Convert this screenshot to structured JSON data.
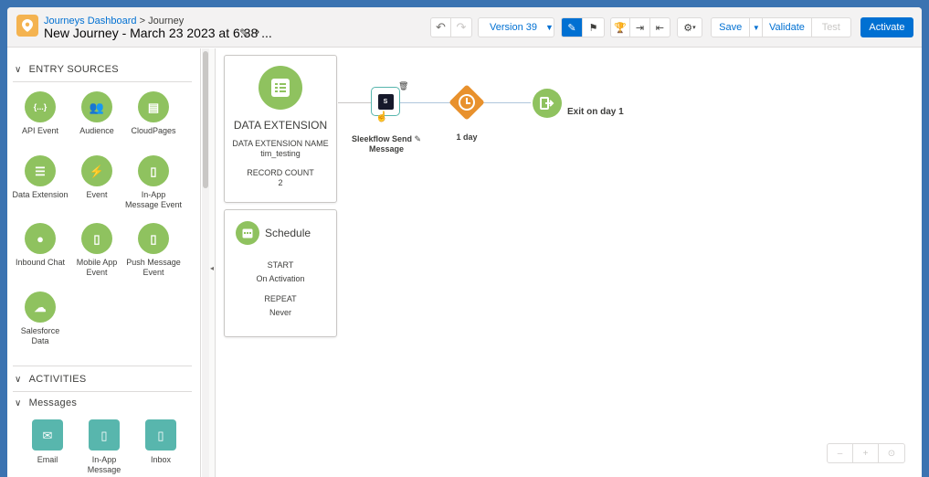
{
  "header": {
    "breadcrumb_link": "Journeys Dashboard",
    "breadcrumb_sep": ">",
    "breadcrumb_current": "Journey",
    "title": "New Journey - March 23 2023 at 6.38 ...",
    "version_label": "Version 39",
    "save_label": "Save",
    "validate_label": "Validate",
    "test_label": "Test",
    "activate_label": "Activate"
  },
  "sidebar": {
    "entry_sources_title": "ENTRY SOURCES",
    "entry_sources": [
      {
        "label": "API Event",
        "icon": "api-icon",
        "glyph": "{...}"
      },
      {
        "label": "Audience",
        "icon": "audience-icon",
        "glyph": "👥"
      },
      {
        "label": "CloudPages",
        "icon": "cloudpages-icon",
        "glyph": "▤"
      },
      {
        "label": "Data Extension",
        "icon": "data-extension-icon",
        "glyph": "☰"
      },
      {
        "label": "Event",
        "icon": "event-icon",
        "glyph": "⚡"
      },
      {
        "label": "In-App Message Event",
        "icon": "in-app-icon",
        "glyph": "▯"
      },
      {
        "label": "Inbound Chat",
        "icon": "chat-icon",
        "glyph": "●"
      },
      {
        "label": "Mobile App Event",
        "icon": "mobile-app-icon",
        "glyph": "▯"
      },
      {
        "label": "Push Message Event",
        "icon": "push-icon",
        "glyph": "▯"
      },
      {
        "label": "Salesforce Data",
        "icon": "salesforce-icon",
        "glyph": "☁"
      }
    ],
    "activities_title": "ACTIVITIES",
    "messages_title": "Messages",
    "messages": [
      {
        "label": "Email",
        "icon": "email-icon",
        "glyph": "✉"
      },
      {
        "label": "In-App Message",
        "icon": "in-app-message-icon",
        "glyph": "▯"
      },
      {
        "label": "Inbox",
        "icon": "inbox-icon",
        "glyph": "▯"
      }
    ]
  },
  "canvas": {
    "data_extension": {
      "title": "DATA EXTENSION",
      "name_label": "DATA EXTENSION NAME",
      "name_value": "tim_testing",
      "count_label": "RECORD COUNT",
      "count_value": "2"
    },
    "schedule": {
      "title": "Schedule",
      "start_label": "START",
      "start_value": "On Activation",
      "repeat_label": "REPEAT",
      "repeat_value": "Never"
    },
    "nodes": {
      "sleekflow_label_1": "Sleekflow Send",
      "sleekflow_label_2": "Message",
      "wait_label": "1 day",
      "exit_label": "Exit on day 1"
    }
  },
  "colors": {
    "entry_green": "#8fc25f",
    "activity_teal": "#58b6ad",
    "wait_orange": "#e8912d",
    "brand_blue": "#0070d2"
  }
}
